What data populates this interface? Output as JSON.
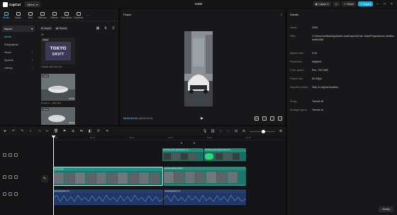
{
  "app": {
    "name": "CapCut",
    "menu_label": "Menu",
    "project_title": "0408",
    "layout_label": "Layout",
    "share_label": "Share",
    "export_label": "Export"
  },
  "media_tabs": [
    {
      "label": "Media",
      "active": true
    },
    {
      "label": "Audio"
    },
    {
      "label": "Text"
    },
    {
      "label": "Stickers"
    },
    {
      "label": "Effects"
    },
    {
      "label": "Transitions"
    },
    {
      "label": "Captions"
    }
  ],
  "media_sidebar": {
    "items": [
      "Import",
      "Media",
      "Subprojects",
      "Yours",
      "Spaces",
      "Library"
    ]
  },
  "media_toolbar": {
    "import_label": "Import",
    "record_label": "Record",
    "all_label": "All"
  },
  "media_items": [
    {
      "badge": "Added",
      "name": "Untitled video (3).mp4",
      "duration": ""
    },
    {
      "badge": "Added",
      "name": "pexels-m..._file).mp4",
      "duration": "00:22"
    },
    {
      "badge": "Added",
      "name": "",
      "duration": "00:14"
    }
  ],
  "player": {
    "title": "Player",
    "current_time": "00:00:02:03",
    "total_time": "00:00:12:02",
    "ratio_label": "Ratio"
  },
  "details": {
    "title": "Details",
    "rows": [
      {
        "key": "Name:",
        "value": "0408"
      },
      {
        "key": "Path:",
        "value": "C:/Users/melfwa/AppData/Local/CapCut/User Data/Projects/com.lveditor.draft/0408"
      },
      {
        "key": "Aspect ratio:",
        "value": "9:16"
      },
      {
        "key": "Resolution:",
        "value": "Adapted"
      },
      {
        "key": "Color space:",
        "value": "Rec. 709 SDR"
      },
      {
        "key": "Frame rate:",
        "value": "60.00fps"
      },
      {
        "key": "Imported media:",
        "value": "Stay in original location"
      },
      {
        "key": "Proxy:",
        "value": "Turned off"
      },
      {
        "key": "Arrange layers:",
        "value": "Turned on"
      }
    ],
    "modify_label": "Modify"
  },
  "timeline": {
    "ruler": [
      "00:00",
      "00:05",
      "00:10",
      "00:15",
      "00:20",
      "00:25"
    ],
    "cover_label": "Cover",
    "overlay_clip_label": "9775caf-aa37-4b44-9c31-72...",
    "overlay_clip_label_2": "9775caf-aa37-4b44-9c31-72...",
    "main_clip_label": "jpe  jpe  jpe",
    "main_clip_label_2": "jpelets  jpelets  jpelets",
    "audio_label": "videoplayback (1)",
    "audio_label_2": "videoplayback (1)"
  },
  "colors": {
    "accent": "#1ea9e0",
    "clip_teal": "#1f8f80",
    "audio_blue": "#2e4f8a"
  }
}
